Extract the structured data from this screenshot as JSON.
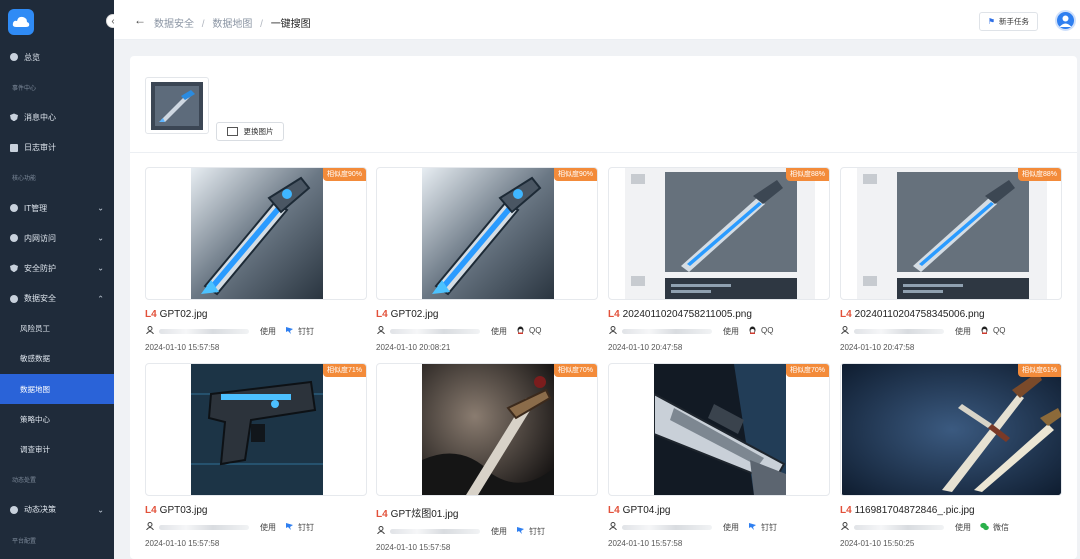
{
  "sidebar": {
    "items": [
      {
        "type": "item",
        "label": "总览",
        "icon": "gear-icon"
      },
      {
        "type": "section",
        "label": "事件中心"
      },
      {
        "type": "item",
        "label": "消息中心",
        "icon": "shield-icon"
      },
      {
        "type": "item",
        "label": "日志审计",
        "icon": "document-icon"
      },
      {
        "type": "section",
        "label": "核心功能"
      },
      {
        "type": "item",
        "label": "IT管理",
        "icon": "gear-icon",
        "chevron": "⌄"
      },
      {
        "type": "item",
        "label": "内网访问",
        "icon": "gear-icon",
        "chevron": "⌄"
      },
      {
        "type": "item",
        "label": "安全防护",
        "icon": "shield-icon",
        "chevron": "⌄"
      },
      {
        "type": "item",
        "label": "数据安全",
        "icon": "gear-icon",
        "chevron": "⌃"
      },
      {
        "type": "sub",
        "label": "风险员工"
      },
      {
        "type": "sub",
        "label": "敏感数据"
      },
      {
        "type": "sub",
        "label": "数据地图",
        "active": true
      },
      {
        "type": "sub",
        "label": "策略中心"
      },
      {
        "type": "sub",
        "label": "调查审计"
      },
      {
        "type": "section",
        "label": "动态处置"
      },
      {
        "type": "item",
        "label": "动态决策",
        "icon": "gear-icon",
        "chevron": "⌄"
      },
      {
        "type": "section",
        "label": "平台配置"
      }
    ]
  },
  "header": {
    "back_icon": "←",
    "breadcrumb": [
      "数据安全",
      "数据地图",
      "一键搜图"
    ],
    "breadcrumb_sep": "/",
    "newbie_label": "新手任务"
  },
  "query": {
    "replace_label": "更换图片"
  },
  "results": [
    {
      "level": "L4",
      "name": "GPT02.jpg",
      "similarity": "相似度90%",
      "use": "使用",
      "app": "钉钉",
      "app_icon": "dingtalk-icon",
      "date": "2024-01-10 15:57:58",
      "art": "sword-blue"
    },
    {
      "level": "L4",
      "name": "GPT02.jpg",
      "similarity": "相似度90%",
      "use": "使用",
      "app": "QQ",
      "app_icon": "qq-icon",
      "date": "2024-01-10 20:08:21",
      "art": "sword-blue"
    },
    {
      "level": "L4",
      "name": "20240110204758211005.png",
      "similarity": "相似度88%",
      "use": "使用",
      "app": "QQ",
      "app_icon": "qq-icon",
      "date": "2024-01-10 20:47:58",
      "art": "screenshot"
    },
    {
      "level": "L4",
      "name": "20240110204758345006.png",
      "similarity": "相似度88%",
      "use": "使用",
      "app": "QQ",
      "app_icon": "qq-icon",
      "date": "2024-01-10 20:47:58",
      "art": "screenshot"
    },
    {
      "level": "L4",
      "name": "GPT03.jpg",
      "similarity": "相似度71%",
      "use": "使用",
      "app": "钉钉",
      "app_icon": "dingtalk-icon",
      "date": "2024-01-10 15:57:58",
      "art": "gun"
    },
    {
      "level": "L4",
      "name": "GPT炫图01.jpg",
      "similarity": "相似度70%",
      "use": "使用",
      "app": "钉钉",
      "app_icon": "dingtalk-icon",
      "date": "2024-01-10 15:57:58",
      "art": "sword-dark"
    },
    {
      "level": "L4",
      "name": "GPT04.jpg",
      "similarity": "相似度70%",
      "use": "使用",
      "app": "钉钉",
      "app_icon": "dingtalk-icon",
      "date": "2024-01-10 15:57:58",
      "art": "blade"
    },
    {
      "level": "L4",
      "name": "116981704872846_.pic.jpg",
      "similarity": "相似度61%",
      "use": "使用",
      "app": "微信",
      "app_icon": "wechat-icon",
      "date": "2024-01-10 15:50:25",
      "art": "knives"
    }
  ],
  "colors": {
    "sidebar_bg": "#1f2b3a",
    "active": "#2a63d8",
    "badge": "#f38b3a",
    "level": "#e2513a",
    "dingtalk": "#2f7ff0",
    "qq": "#d23b2f",
    "wechat": "#2bb14b"
  }
}
